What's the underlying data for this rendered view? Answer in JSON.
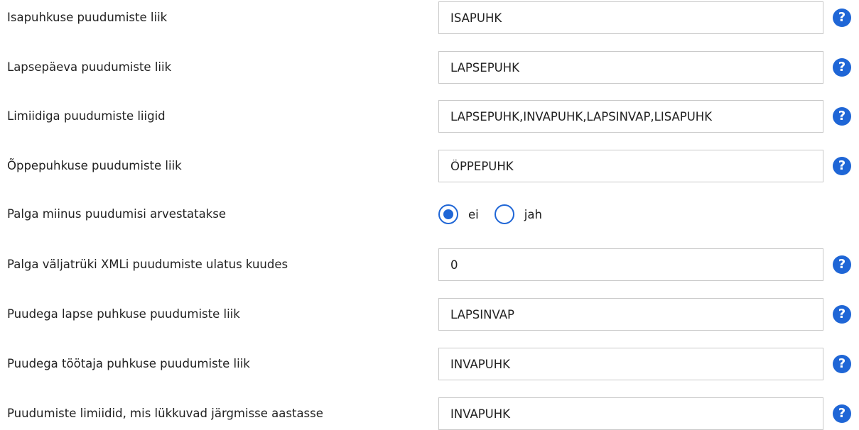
{
  "rows": [
    {
      "label": "Isapuhkuse puudumiste liik",
      "value": "ISAPUHK",
      "help": "?"
    },
    {
      "label": "Lapsepäeva puudumiste liik",
      "value": "LAPSEPUHK",
      "help": "?"
    },
    {
      "label": "Limiidiga puudumiste liigid",
      "value": "LAPSEPUHK,INVAPUHK,LAPSINVAP,LISAPUHK",
      "help": "?"
    },
    {
      "label": "Õppepuhkuse puudumiste liik",
      "value": "ÕPPEPUHK",
      "help": "?"
    },
    {
      "label": "Palga miinus puudumisi arvestatakse",
      "options": [
        "ei",
        "jah"
      ],
      "selected": "ei"
    },
    {
      "label": "Palga väljatrüki XMLi puudumiste ulatus kuudes",
      "value": "0",
      "help": "?"
    },
    {
      "label": "Puudega lapse puhkuse puudumiste liik",
      "value": "LAPSINVAP",
      "help": "?"
    },
    {
      "label": "Puudega töötaja puhkuse puudumiste liik",
      "value": "INVAPUHK",
      "help": "?"
    },
    {
      "label": "Puudumiste limiidid, mis lükkuvad järgmisse aastasse",
      "value": "INVAPUHK",
      "help": "?"
    }
  ],
  "colors": {
    "accent": "#1f66d6",
    "border": "#c9c9c9",
    "text": "#222222"
  },
  "icons": {
    "help": "question-circle-icon"
  }
}
